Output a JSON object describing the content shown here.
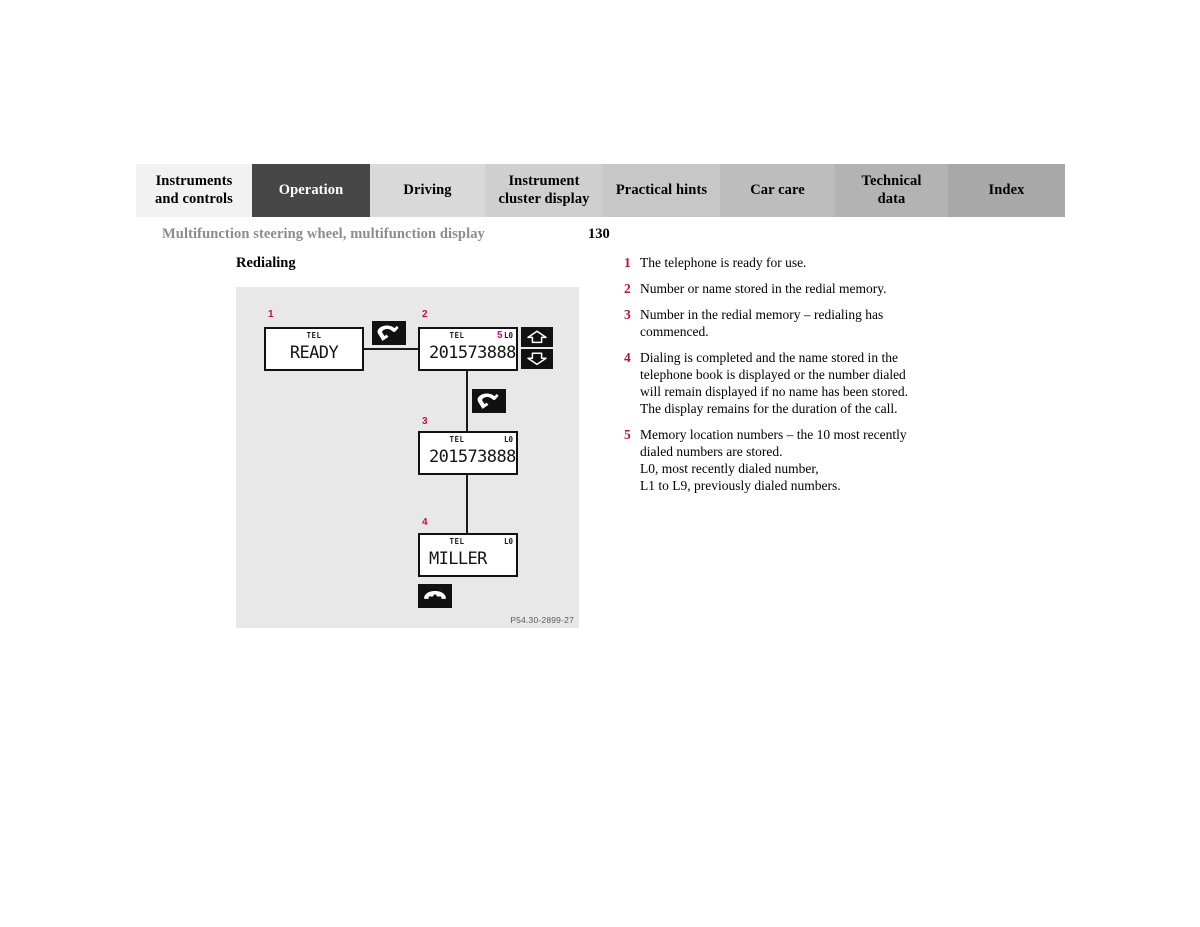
{
  "colors": {
    "accent_red": "#c8102e",
    "accent_magenta": "#e6007e",
    "panel_bg": "#e8e8e8",
    "active_tab_bg": "#474747",
    "header_gray": "#8c8c8c"
  },
  "tabbar": {
    "tabs": [
      {
        "label": "Instruments\nand controls",
        "bg": "#f2f2f2",
        "active": false
      },
      {
        "label": "Operation",
        "bg": "#474747",
        "active": true
      },
      {
        "label": "Driving",
        "bg": "#d9d9d9",
        "active": false
      },
      {
        "label": "Instrument\ncluster display",
        "bg": "#cfcfcf",
        "active": false
      },
      {
        "label": "Practical hints",
        "bg": "#c7c7c7",
        "active": false
      },
      {
        "label": "Car care",
        "bg": "#bdbdbd",
        "active": false
      },
      {
        "label": "Technical\ndata",
        "bg": "#b3b3b3",
        "active": false
      },
      {
        "label": "Index",
        "bg": "#a8a8a8",
        "active": false
      }
    ]
  },
  "header": {
    "running_title": "Multifunction steering wheel, multifunction display",
    "page_number": "130"
  },
  "section": {
    "title": "Redialing"
  },
  "figure": {
    "caption": "P54.30-2899-27",
    "displays": [
      {
        "callout": "1",
        "tel": "TEL",
        "loc": "",
        "value": "READY"
      },
      {
        "callout": "2",
        "tel": "TEL",
        "loc": "L0",
        "value": "201573888",
        "loc_callout": "5"
      },
      {
        "callout": "3",
        "tel": "TEL",
        "loc": "L0",
        "value": "201573888"
      },
      {
        "callout": "4",
        "tel": "TEL",
        "loc": "L0",
        "value": "MILLER"
      }
    ],
    "icons": {
      "pickup_1": "phone-pickup-icon",
      "pickup_2": "phone-pickup-icon",
      "hangup": "phone-hangup-icon",
      "scroll_up": "scroll-up-icon",
      "scroll_down": "scroll-down-icon"
    }
  },
  "legend": {
    "items": [
      {
        "num": "1",
        "text": "The telephone is ready for use."
      },
      {
        "num": "2",
        "text": "Number or name stored in the redial memory."
      },
      {
        "num": "3",
        "text": "Number in the redial memory – redialing has\ncommenced."
      },
      {
        "num": "4",
        "text": "Dialing is completed and the name stored in the\ntelephone book is displayed or the number dialed\nwill remain displayed if no name has been stored.\nThe display remains for the duration of the call."
      },
      {
        "num": "5",
        "text": "Memory location numbers – the 10 most recently\ndialed numbers are stored.\nL0, most recently dialed number,\nL1 to L9, previously dialed numbers."
      }
    ]
  }
}
